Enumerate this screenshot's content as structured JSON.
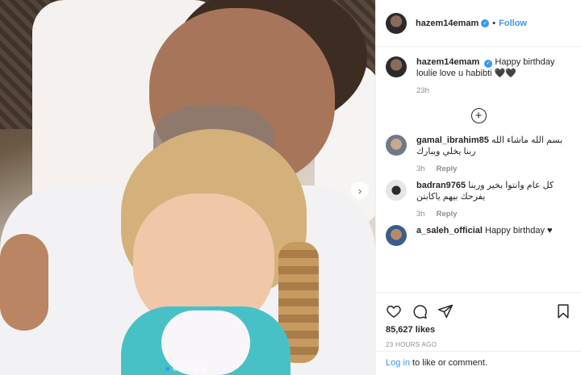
{
  "post": {
    "username": "hazem14emam",
    "follow_label": "Follow",
    "separator": "•",
    "caption_text": "Happy birthday loulie love u habibti 🖤🖤",
    "caption_time": "23h",
    "likes": "85,627 likes",
    "posted_time": "23 HOURS AGO"
  },
  "comments": [
    {
      "username": "gamal_ibrahim85",
      "text": "بسم الله ماشاء الله ربنا يخلي ويبارك",
      "time": "3h",
      "reply_label": "Reply"
    },
    {
      "username": "badran9765",
      "text": "كل عام وانتوا بخير وربنا يفرحك بيهم ياكابتن",
      "time": "3h",
      "reply_label": "Reply"
    },
    {
      "username": "a_saleh_official",
      "text": "Happy birthday ♥"
    }
  ],
  "login": {
    "link_label": "Log in",
    "rest_text": " to like or comment."
  },
  "carousel": {
    "slide_count": 6,
    "active_index": 0
  },
  "icons": [
    "heart-icon",
    "comment-icon",
    "share-icon",
    "bookmark-icon",
    "add-comments-icon",
    "next-arrow-icon",
    "verified-icon"
  ],
  "colors": {
    "accent": "#3897f0",
    "text": "#262626",
    "muted": "#8e8e8e"
  }
}
